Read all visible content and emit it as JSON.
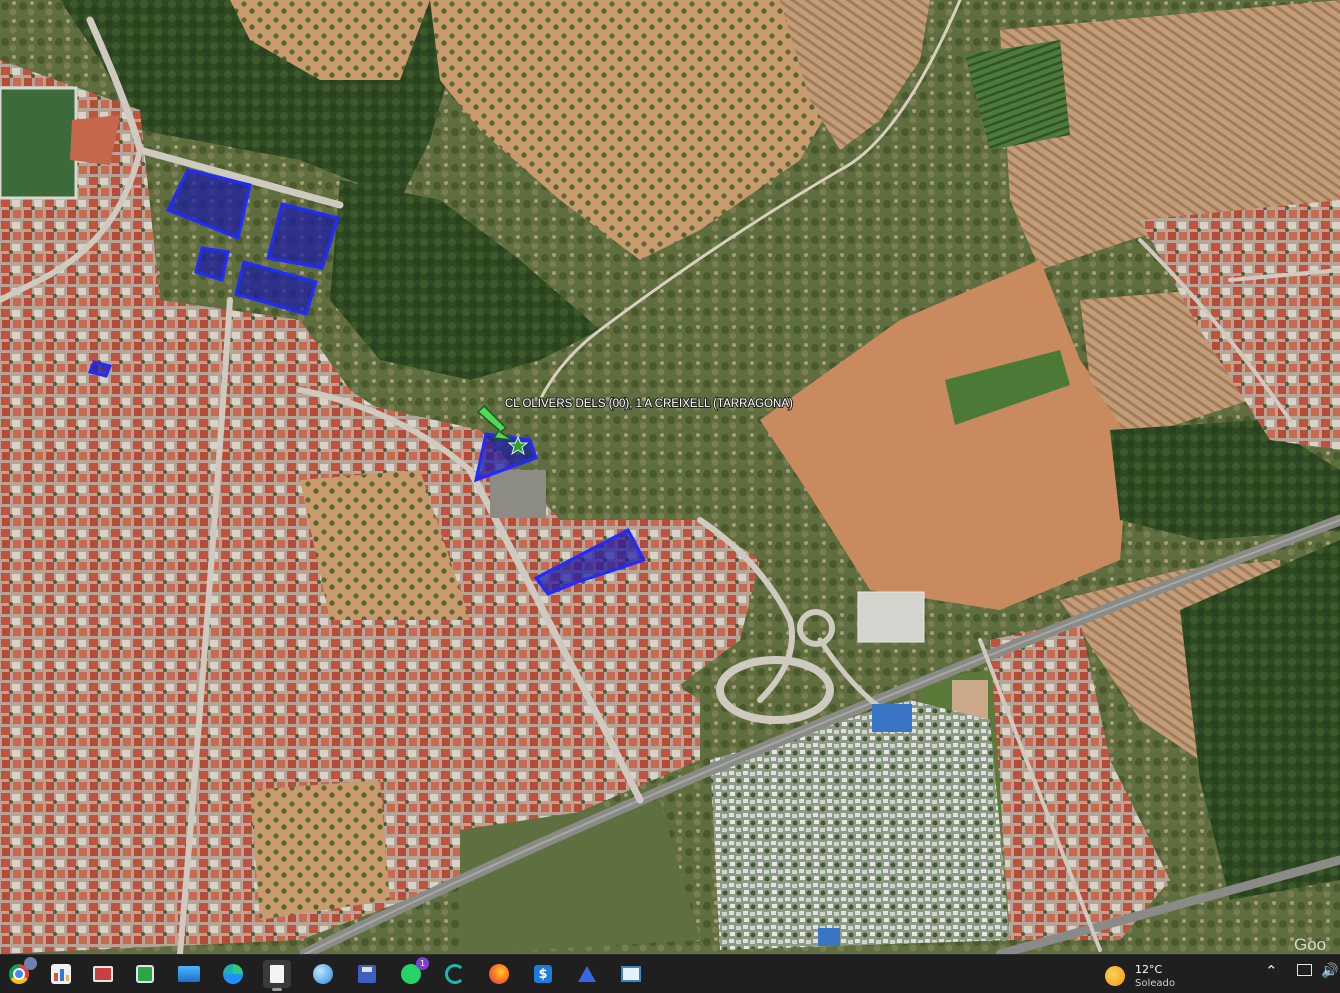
{
  "map": {
    "location_label": "CL OLIVERS DELS (00), 1 A CREIXELL (TARRAGONA)",
    "watermark": "Goo",
    "colors": {
      "parcel_fill": "#1a1aa6",
      "parcel_stroke": "#1f2bff",
      "marker_arrow": "#4fd85a",
      "marker_star": "#2f9e3a"
    }
  },
  "taskbar": {
    "icons": [
      {
        "name": "chrome-icon",
        "badge": ""
      },
      {
        "name": "app-chart-icon",
        "badge": ""
      },
      {
        "name": "window-app-icon",
        "badge": ""
      },
      {
        "name": "file-transfer-icon",
        "badge": ""
      },
      {
        "name": "photos-icon",
        "badge": ""
      },
      {
        "name": "edge-icon",
        "badge": ""
      },
      {
        "name": "document-icon",
        "badge": ""
      },
      {
        "name": "globe-icon",
        "badge": ""
      },
      {
        "name": "save-disk-icon",
        "badge": ""
      },
      {
        "name": "whatsapp-icon",
        "badge": "1"
      },
      {
        "name": "wave-app-icon",
        "badge": ""
      },
      {
        "name": "firefox-icon",
        "badge": ""
      },
      {
        "name": "dollar-app-icon",
        "badge": ""
      },
      {
        "name": "arc-app-icon",
        "badge": ""
      },
      {
        "name": "table-app-icon",
        "badge": ""
      }
    ],
    "weather": {
      "temperature": "12°C",
      "condition": "Soleado"
    }
  }
}
